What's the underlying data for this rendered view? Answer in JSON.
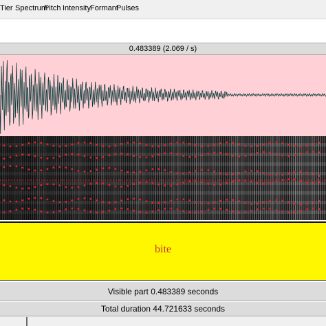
{
  "menu": {
    "items": [
      "Tier",
      "Spectrum",
      "Pitch",
      "Intensity",
      "Formant",
      "Pulses"
    ]
  },
  "selection": {
    "text": "0.483389 (2.069 / s)"
  },
  "tier": {
    "label": "bite"
  },
  "status": {
    "visible_part": "Visible part 0.483389 seconds",
    "total_duration": "Total duration 44.721633 seconds"
  },
  "colors": {
    "waveform_bg": "#ffd1d6",
    "waveform_line": "#0b3a3a",
    "tier_bg": "#fff700",
    "tier_text": "#c0392b",
    "formant_dots": "#e8202a",
    "pitch_line": "#e8202a"
  }
}
